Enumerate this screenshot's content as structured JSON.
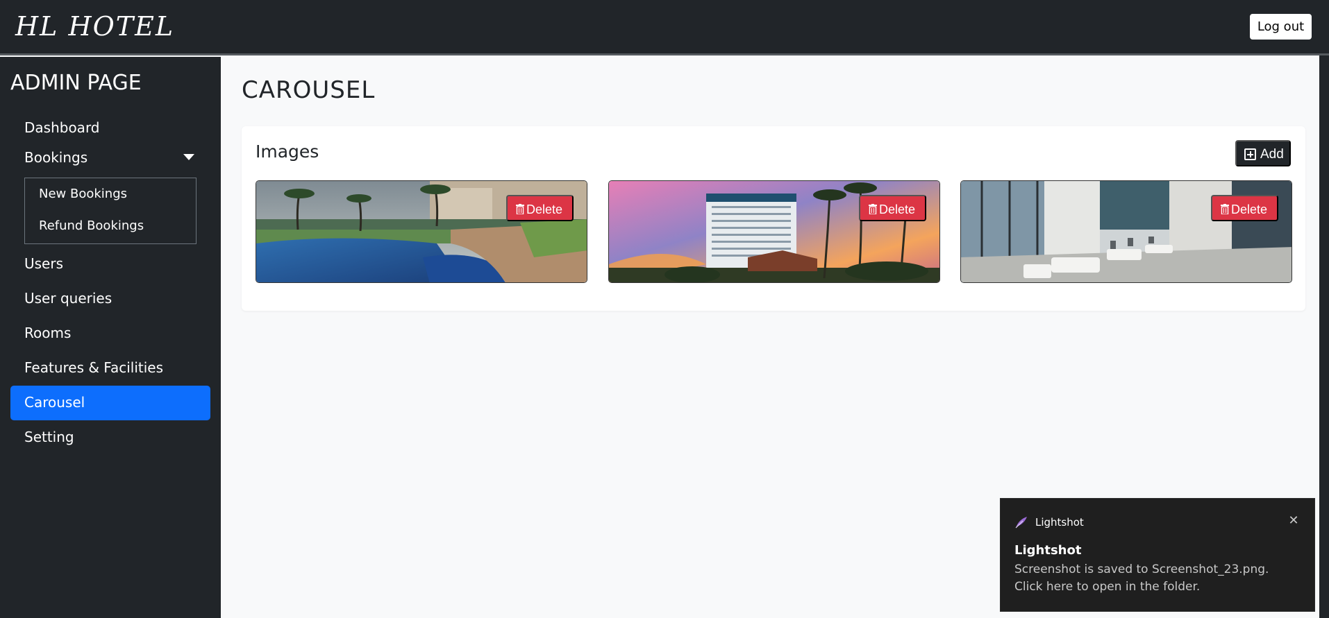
{
  "header": {
    "brand": "HL HOTEL",
    "logout_label": "Log out"
  },
  "sidebar": {
    "title": "ADMIN PAGE",
    "items": [
      {
        "label": "Dashboard"
      },
      {
        "label": "Bookings"
      },
      {
        "label": "Users"
      },
      {
        "label": "User queries"
      },
      {
        "label": "Rooms"
      },
      {
        "label": "Features & Facilities"
      },
      {
        "label": "Carousel"
      },
      {
        "label": "Setting"
      }
    ],
    "bookings_submenu": [
      {
        "label": "New Bookings"
      },
      {
        "label": "Refund Bookings"
      }
    ],
    "active_item": "Carousel"
  },
  "main": {
    "page_title": "CAROUSEL",
    "card_title": "Images",
    "add_label": "Add",
    "images": [
      {
        "delete_label": "Delete"
      },
      {
        "delete_label": "Delete"
      },
      {
        "delete_label": "Delete"
      }
    ]
  },
  "toast": {
    "app_name": "Lightshot",
    "close_glyph": "✕",
    "title": "Lightshot",
    "message": "Screenshot is saved to Screenshot_23.png. Click here to open in the folder."
  },
  "colors": {
    "dark": "#212529",
    "primary": "#0d6efd",
    "danger": "#dc3545",
    "page_bg": "#f8f9fa"
  }
}
